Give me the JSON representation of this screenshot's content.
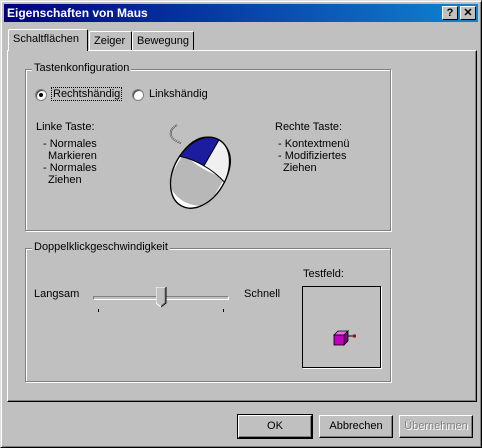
{
  "window": {
    "title": "Eigenschaften von Maus",
    "help_label": "?",
    "close_label": "✕"
  },
  "tabs": [
    {
      "label": "Schaltflächen",
      "active": true
    },
    {
      "label": "Zeiger",
      "active": false
    },
    {
      "label": "Bewegung",
      "active": false
    }
  ],
  "button_config": {
    "group_label": "Tastenkonfiguration",
    "right_handed_label": "Rechtshändig",
    "left_handed_label": "Linkshändig",
    "selected": "Rechtshändig",
    "left_button_title": "Linke Taste:",
    "left_button_items": [
      "- Normales",
      "Markieren",
      "- Normales",
      "Ziehen"
    ],
    "right_button_title": "Rechte Taste:",
    "right_button_items": [
      "- Kontextmenü",
      "- Modifiziertes",
      "Ziehen"
    ]
  },
  "double_click": {
    "group_label": "Doppelklickgeschwindigkeit",
    "slow_label": "Langsam",
    "fast_label": "Schnell",
    "test_field_label": "Testfeld:",
    "slider_position": 0.5
  },
  "footer": {
    "ok_label": "OK",
    "cancel_label": "Abbrechen",
    "apply_label": "Übernehmen"
  },
  "colors": {
    "titlebar_start": "#000080",
    "titlebar_end": "#1084d0",
    "face": "#c0c0c0",
    "mouse_button_highlight": "#1c1ca0",
    "test_box": "#c000c0"
  }
}
